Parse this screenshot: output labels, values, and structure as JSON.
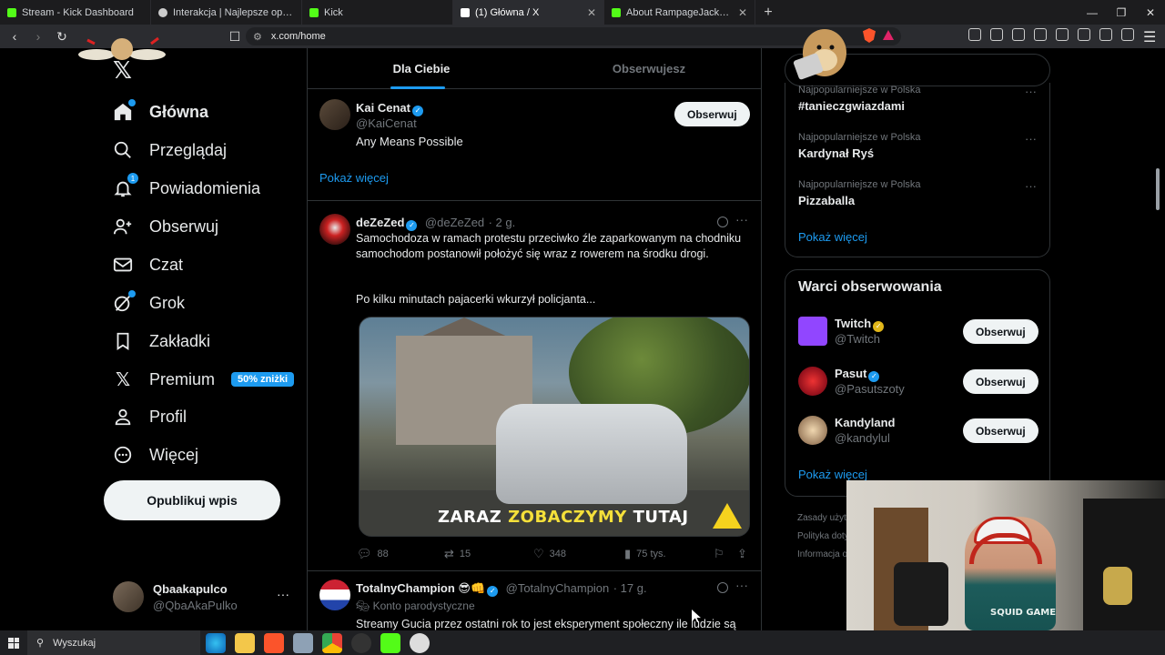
{
  "browser": {
    "tabs": [
      {
        "title": "Stream - Kick Dashboard",
        "favicon_color": "#53fc18",
        "active": false
      },
      {
        "title": "Interakcja | Najlepsze oprogramowanie",
        "favicon_color": "#cccccc",
        "active": false
      },
      {
        "title": "Kick",
        "favicon_color": "#53fc18",
        "active": false
      },
      {
        "title": "(1) Główna / X",
        "favicon_color": "#ffffff",
        "active": true
      },
      {
        "title": "About RampageJackson - Watch Live",
        "favicon_color": "#53fc18",
        "active": false
      }
    ],
    "new_tab": "+",
    "url": "x.com/home"
  },
  "leftnav": {
    "logo": "𝕏",
    "items": [
      {
        "label": "Główna",
        "icon": "home-icon",
        "bold": true
      },
      {
        "label": "Przeglądaj",
        "icon": "search-icon"
      },
      {
        "label": "Powiadomienia",
        "icon": "bell-icon",
        "badge": "1"
      },
      {
        "label": "Obserwuj",
        "icon": "follow-icon"
      },
      {
        "label": "Czat",
        "icon": "mail-icon"
      },
      {
        "label": "Grok",
        "icon": "grok-icon"
      },
      {
        "label": "Zakładki",
        "icon": "bookmark-icon"
      },
      {
        "label": "Premium",
        "icon": "x-icon",
        "badge": "50% zniżki"
      },
      {
        "label": "Profil",
        "icon": "profile-icon"
      },
      {
        "label": "Więcej",
        "icon": "more-circle-icon"
      }
    ],
    "post_button": "Opublikuj wpis",
    "account": {
      "name": "Qbaakapulco",
      "handle": "@QbaAkaPulko",
      "more": "···"
    }
  },
  "feed": {
    "tabs": [
      "Dla Ciebie",
      "Obserwujesz"
    ],
    "active_tab": 0,
    "suggest": {
      "name": "Kai Cenat",
      "handle": "@KaiCenat",
      "bio": "Any Means Possible",
      "follow": "Obserwuj",
      "show_more": "Pokaż więcej"
    },
    "tweet1": {
      "name": "deZeZed",
      "handle": "@deZeZed",
      "time": "· 2 g.",
      "text1": "Samochodoza w ramach protestu przeciwko źle zaparkowanym na chodniku samochodom postanowił położyć się wraz z rowerem na środku drogi.",
      "text2": "Po kilku minutach pajacerki wkurzył policjanta...",
      "media_caption_a": "ZARAZ ",
      "media_caption_b": "ZOBACZYMY",
      "media_caption_c": " TUTAJ",
      "replies": "88",
      "reposts": "15",
      "likes": "348",
      "views": "75 tys."
    },
    "tweet2": {
      "name": "TotalnyChampion 😎👊",
      "handle": "@TotalnyChampion",
      "time": "· 17 g.",
      "label": "Konto parodystyczne",
      "text": "Streamy Gucia przez ostatni rok to jest eksperyment społeczny ile ludzie są"
    }
  },
  "right": {
    "trends": [
      {
        "context": "Najpopularniejsze w Polska",
        "title": "#tanieczgwiazdami"
      },
      {
        "context": "Najpopularniejsze w Polska",
        "title": "Kardynał Ryś"
      },
      {
        "context": "Najpopularniejsze w Polska",
        "title": "Pizzaballa"
      }
    ],
    "trends_more": "Pokaż więcej",
    "who_title": "Warci obserwowania",
    "who": [
      {
        "name": "Twitch",
        "handle": "@Twitch",
        "gold": true,
        "color": "#9146ff",
        "follow": "Obserwuj"
      },
      {
        "name": "Pasut",
        "handle": "@Pasutszoty",
        "gold": false,
        "color": "#a02030",
        "follow": "Obserwuj"
      },
      {
        "name": "Kandyland",
        "handle": "@kandylul",
        "gold": false,
        "color": "#c9a070",
        "follow": "Obserwuj"
      }
    ],
    "who_more": "Pokaż więcej",
    "footer": [
      "Zasady użytk",
      "Polityka doty",
      "Informacja o"
    ]
  },
  "webcam": {
    "shirt": "SQUID GAME"
  },
  "taskbar": {
    "search": "Wyszukaj"
  },
  "colors": {
    "accent": "#1d9bf0",
    "background": "#000000",
    "border": "#2f3336",
    "muted": "#71767b"
  }
}
